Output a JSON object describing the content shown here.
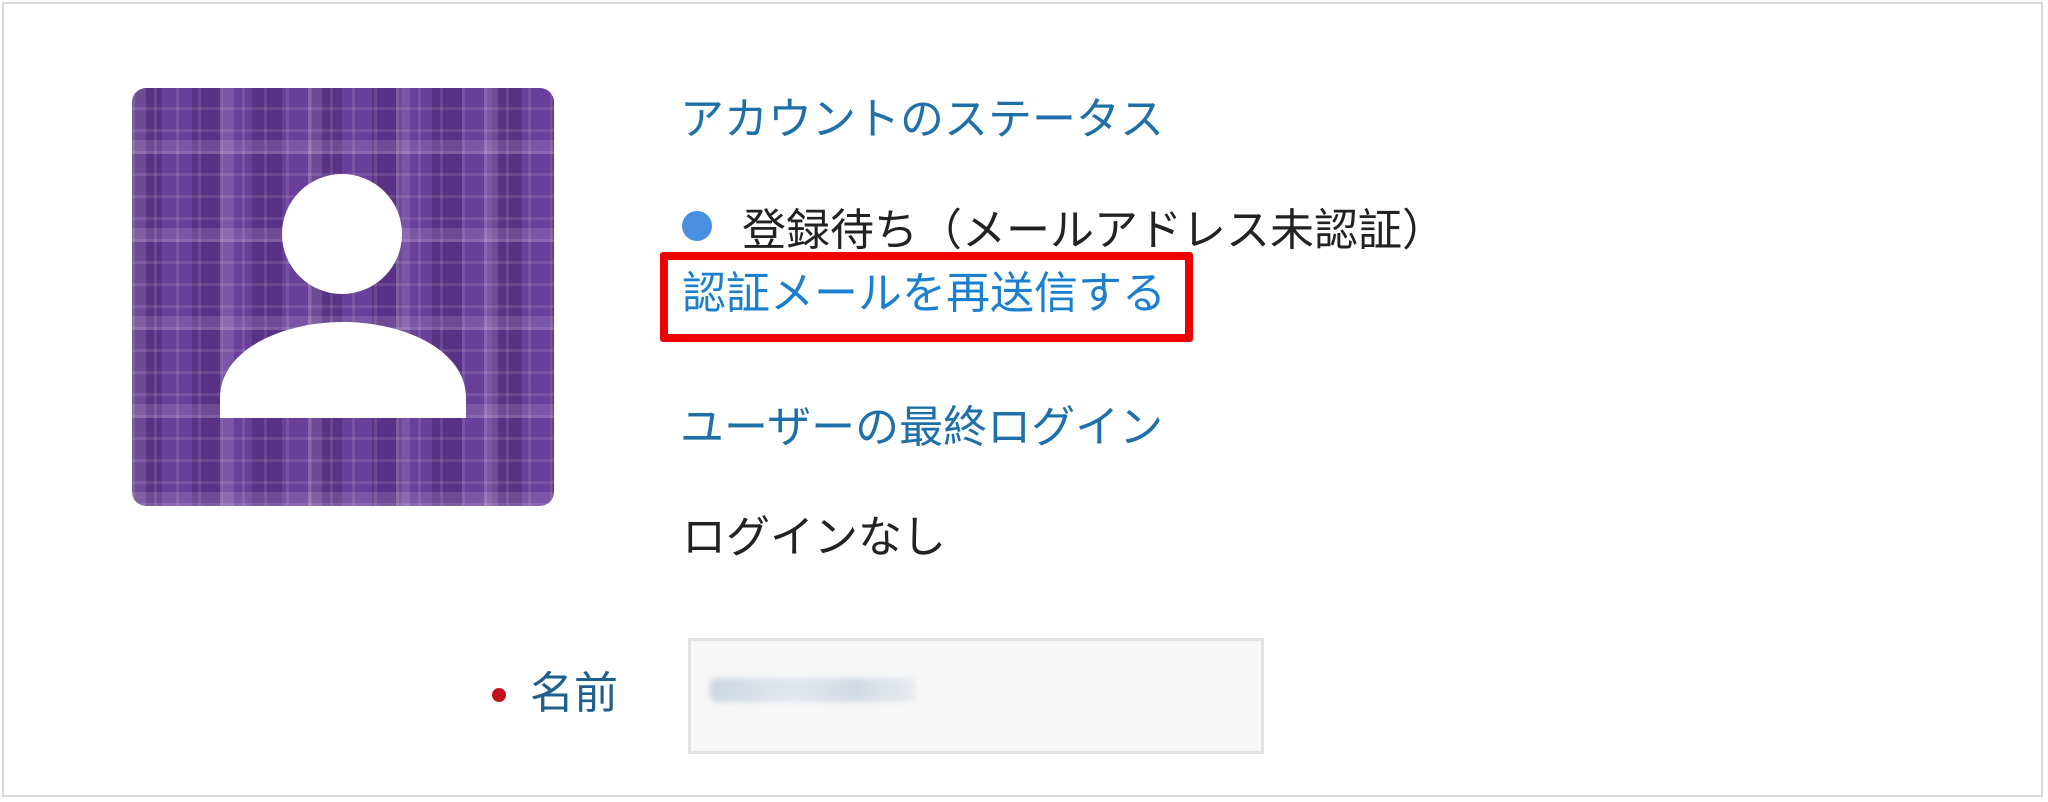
{
  "profile": {
    "avatar_icon": "person-silhouette-icon"
  },
  "account_status": {
    "heading": "アカウントのステータス",
    "status_text": "登録待ち（メールアドレス未認証）",
    "status_color": "#4a90e2",
    "resend_link": "認証メールを再送信する",
    "highlight_color": "#ee0000"
  },
  "last_login": {
    "heading": "ユーザーの最終ログイン",
    "value": "ログインなし"
  },
  "form": {
    "name_label": "名前",
    "required_color": "#c0121e"
  }
}
